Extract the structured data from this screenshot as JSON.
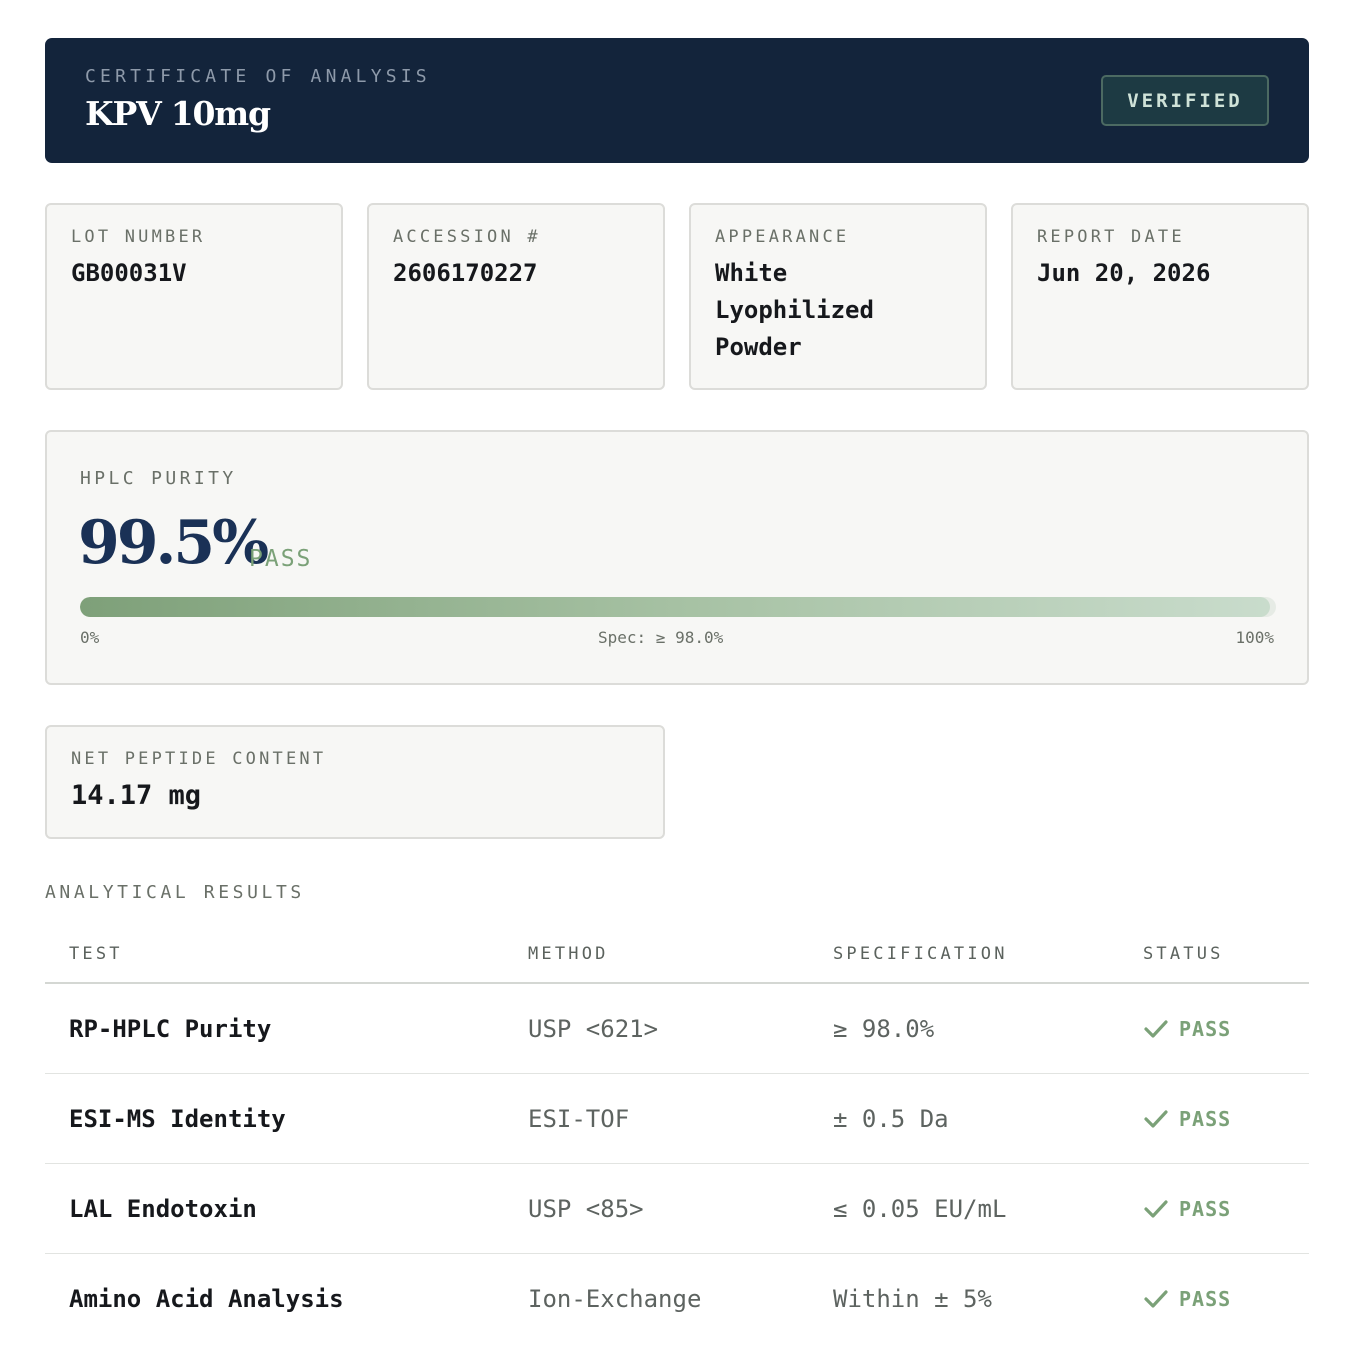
{
  "header": {
    "eyebrow": "CERTIFICATE OF ANALYSIS",
    "title": "KPV 10mg",
    "badge": "VERIFIED",
    "colors": {
      "background": "#13243b",
      "badge_border": "#4c6a62"
    }
  },
  "info_cards": [
    {
      "label": "LOT NUMBER",
      "value": "GB00031V"
    },
    {
      "label": "ACCESSION #",
      "value": "2606170227"
    },
    {
      "label": "APPEARANCE",
      "value": "White Lyophilized Powder"
    },
    {
      "label": "REPORT DATE",
      "value": "Jun 20, 2026"
    }
  ],
  "purity": {
    "label": "HPLC PURITY",
    "value": "99.5%",
    "percent": 99.5,
    "status": "PASS",
    "min_label": "0%",
    "spec_label": "Spec: ≥ 98.0%",
    "max_label": "100%",
    "colors": {
      "value": "#1a3156",
      "pass": "#7ba178"
    }
  },
  "net_peptide": {
    "label": "NET PEPTIDE CONTENT",
    "value": "14.17 mg"
  },
  "results": {
    "title": "ANALYTICAL RESULTS",
    "columns": [
      "TEST",
      "METHOD",
      "SPECIFICATION",
      "STATUS"
    ],
    "rows": [
      {
        "test": "RP-HPLC Purity",
        "method": "USP <621>",
        "spec": "≥ 98.0%",
        "status": "PASS",
        "icon": "check-icon"
      },
      {
        "test": "ESI-MS Identity",
        "method": "ESI-TOF",
        "spec": "± 0.5 Da",
        "status": "PASS",
        "icon": "check-icon"
      },
      {
        "test": "LAL Endotoxin",
        "method": "USP <85>",
        "spec": "≤ 0.05 EU/mL",
        "status": "PASS",
        "icon": "check-icon"
      },
      {
        "test": "Amino Acid Analysis",
        "method": "Ion-Exchange",
        "spec": "Within ± 5%",
        "status": "PASS",
        "icon": "check-icon"
      }
    ]
  }
}
